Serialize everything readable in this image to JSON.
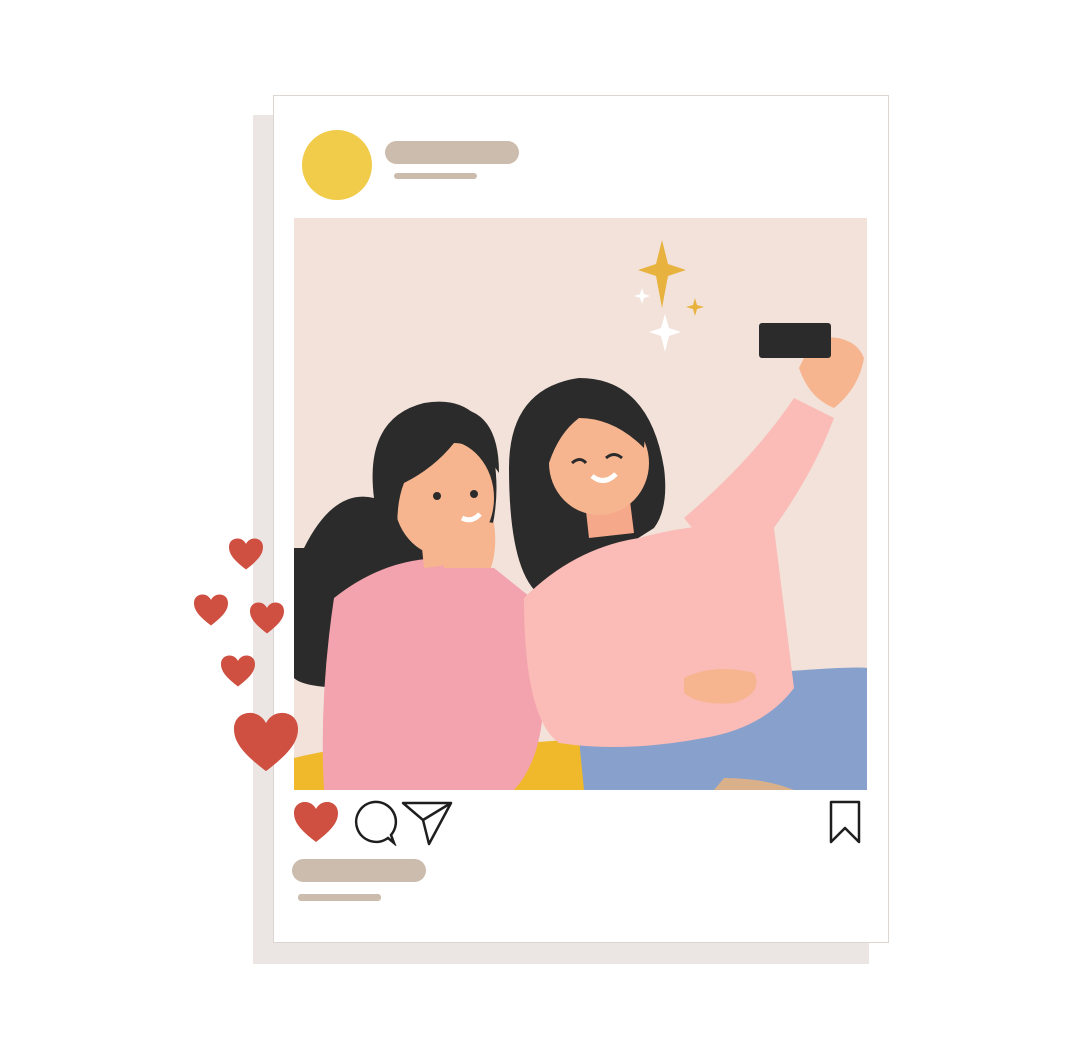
{
  "post": {
    "avatar_color": "#f1cc4a",
    "placeholder_color": "#cbbcad",
    "photo_background": "#f2e2da"
  },
  "actions": {
    "icons": [
      "heart-icon",
      "comment-icon",
      "share-icon",
      "bookmark-icon"
    ],
    "liked": true,
    "like_color": "#cf4f40"
  },
  "decor": {
    "floating_hearts_count": 5,
    "heart_color": "#cf4f40",
    "sparkle_colors": [
      "#e8b23f",
      "#ffffff"
    ]
  }
}
